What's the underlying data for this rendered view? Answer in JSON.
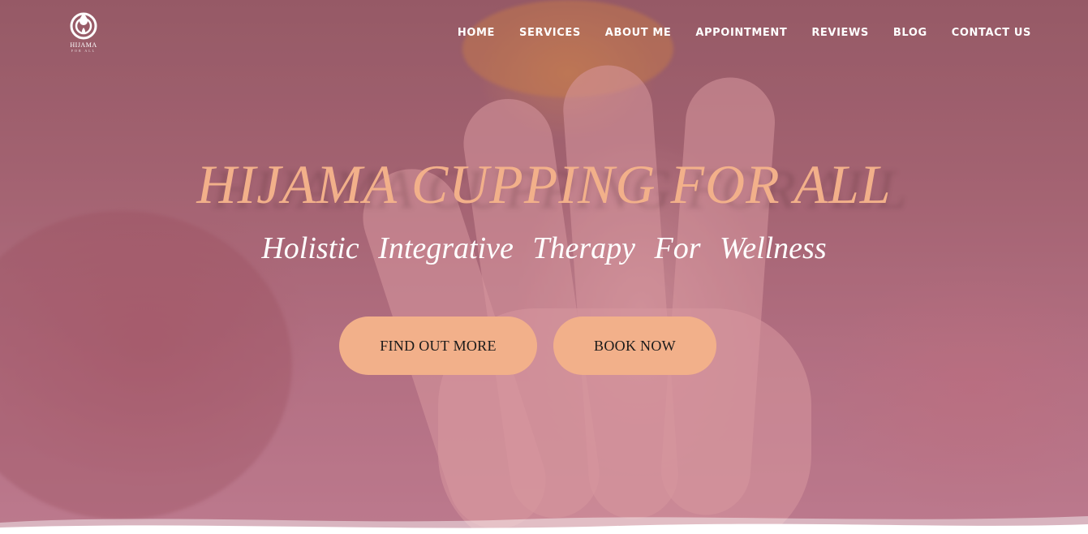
{
  "logo": {
    "name": "HIJAMA",
    "sub": "FOR ALL"
  },
  "nav": {
    "items": [
      "HOME",
      "SERVICES",
      "ABOUT ME",
      "APPOINTMENT",
      "REVIEWS",
      "BLOG",
      "CONTACT US"
    ]
  },
  "hero": {
    "title": "HIJAMA CUPPING FOR ALL",
    "subtitle": "Holistic Integrative Therapy For Wellness",
    "find_out_more": "FIND OUT MORE",
    "book_now": "BOOK NOW"
  },
  "colors": {
    "accent": "#f2b08a",
    "overlay": "#aa506e",
    "text_light": "#ffffff"
  }
}
